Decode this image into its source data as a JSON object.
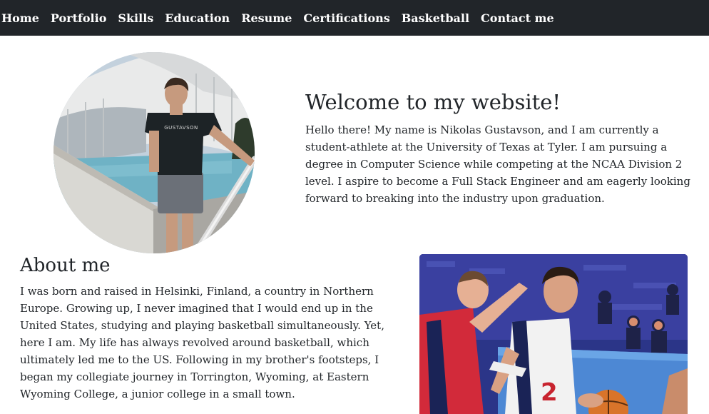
{
  "nav": {
    "items": [
      {
        "label": "Home"
      },
      {
        "label": "Portfolio"
      },
      {
        "label": "Skills"
      },
      {
        "label": "Education"
      },
      {
        "label": "Resume"
      },
      {
        "label": "Certifications"
      },
      {
        "label": "Basketball"
      },
      {
        "label": "Contact me"
      }
    ]
  },
  "welcome": {
    "title": "Welcome to my website!",
    "text": "Hello there! My name is Nikolas Gustavson, and I am currently a student-athlete at the University of Texas at Tyler. I am pursuing a degree in Computer Science while competing at the NCAA Division 2 level. I aspire to become a Full Stack Engineer and am eagerly looking forward to breaking into the industry upon graduation."
  },
  "about": {
    "title": "About me",
    "text": "I was born and raised in Helsinki, Finland, a country in Northern Europe. Growing up, I never imagined that I would end up in the United States, studying and playing basketball simultaneously. Yet, here I am. My life has always revolved around basketball, which ultimately led me to the US. Following in my brother's footsteps, I began my collegiate journey in Torrington, Wyoming, at Eastern Wyoming College, a junior college in a small town."
  },
  "images": {
    "profile_shirt_text": "GUSTAVSON",
    "jersey_number": "2"
  },
  "colors": {
    "navbar": "#212529",
    "nav_text": "#ffffff",
    "body_text": "#212529",
    "background": "#ffffff"
  }
}
